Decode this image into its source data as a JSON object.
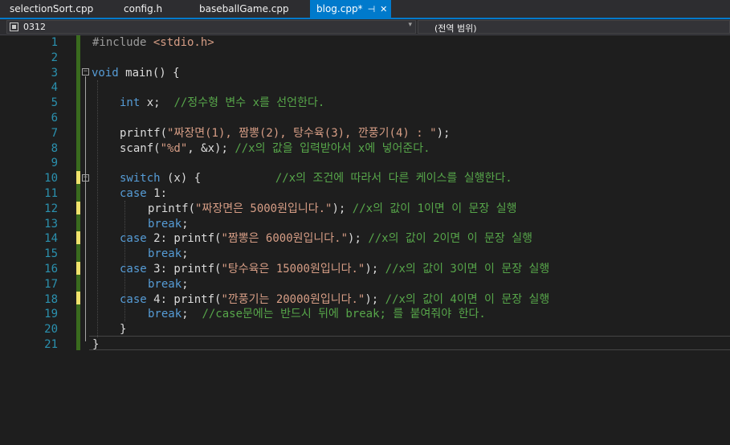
{
  "tabs": [
    {
      "label": "selectionSort.cpp",
      "active": false
    },
    {
      "label": "config.h",
      "active": false
    },
    {
      "label": "baseballGame.cpp",
      "active": false
    },
    {
      "label": "blog.cpp*",
      "active": true
    }
  ],
  "tab_pin_icon": "pin-icon",
  "tab_close_icon": "close-icon",
  "navbar": {
    "project": "0312",
    "scope": "(전역 범위)"
  },
  "line_numbers": [
    "1",
    "2",
    "3",
    "4",
    "5",
    "6",
    "7",
    "8",
    "9",
    "10",
    "11",
    "12",
    "13",
    "14",
    "15",
    "16",
    "17",
    "18",
    "19",
    "20",
    "21"
  ],
  "code": {
    "l1_pre": "#include ",
    "l1_inc": "<stdio.h>",
    "l3_kw": "void",
    "l3_rest": " main() {",
    "l5_kw": "int",
    "l5_rest": " x;  ",
    "l5_cm": "//정수형 변수 x를 선언한다.",
    "l7": "printf(",
    "l7_str": "\"짜장면(1), 짬뽕(2), 탕수육(3), 깐풍기(4) : \"",
    "l7_end": ");",
    "l8": "scanf(",
    "l8_str": "\"%d\"",
    "l8_rest": ", &x); ",
    "l8_cm": "//x의 값을 입력받아서 x에 넣어준다.",
    "l10_kw": "switch",
    "l10_rest": " (x) {           ",
    "l10_cm": "//x의 조건에 따라서 다른 케이스를 실행한다.",
    "l11_kw": "case",
    "l11_rest": " 1:",
    "l12": "printf(",
    "l12_str": "\"짜장면은 5000원입니다.\"",
    "l12_end": "); ",
    "l12_cm": "//x의 값이 1이면 이 문장 실행",
    "l13_kw": "break",
    "l13_rest": ";",
    "l14_kw": "case",
    "l14_rest": " 2: printf(",
    "l14_str": "\"짬뽕은 6000원입니다.\"",
    "l14_end": "); ",
    "l14_cm": "//x의 값이 2이면 이 문장 실행",
    "l15_kw": "break",
    "l15_rest": ";",
    "l16_kw": "case",
    "l16_rest": " 3: printf(",
    "l16_str": "\"탕수육은 15000원입니다.\"",
    "l16_end": "); ",
    "l16_cm": "//x의 값이 3이면 이 문장 실행",
    "l17_kw": "break",
    "l17_rest": ";",
    "l18_kw": "case",
    "l18_rest": " 4: printf(",
    "l18_str": "\"깐풍기는 20000원입니다.\"",
    "l18_end": "); ",
    "l18_cm": "//x의 값이 4이면 이 문장 실행",
    "l19_kw": "break",
    "l19_rest": ";  ",
    "l19_cm": "//case문에는 반드시 뒤에 break; 를 붙여줘야 한다.",
    "l20": "}",
    "l21": "}"
  },
  "colors": {
    "keyword": "#569cd6",
    "string": "#d69d85",
    "comment": "#57a64a",
    "line_number": "#2b91af",
    "accent": "#007acc"
  }
}
